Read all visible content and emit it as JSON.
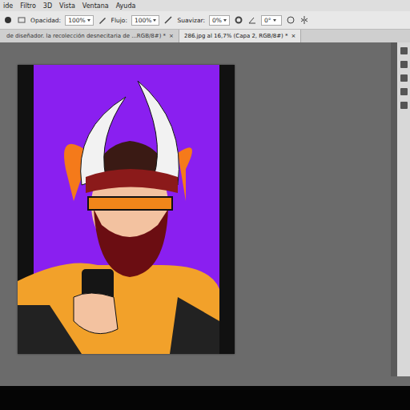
{
  "menu": [
    "ide",
    "Filtro",
    "3D",
    "Vista",
    "Ventana",
    "Ayuda"
  ],
  "options": {
    "opacity_label": "Opacidad:",
    "opacity": "100%",
    "flow_label": "Flujo:",
    "flow": "100%",
    "smooth_label": "Suavizar:",
    "smooth": "0%",
    "angle": "0°"
  },
  "tabs": [
    {
      "label": "de diseñador. la recolección desnecitaria de ...RGB/8#) *",
      "close": "×",
      "selected": false
    },
    {
      "label": "286.jpg al 16,7% (Capa 2, RGB/8#) *",
      "close": "×",
      "selected": true
    }
  ]
}
